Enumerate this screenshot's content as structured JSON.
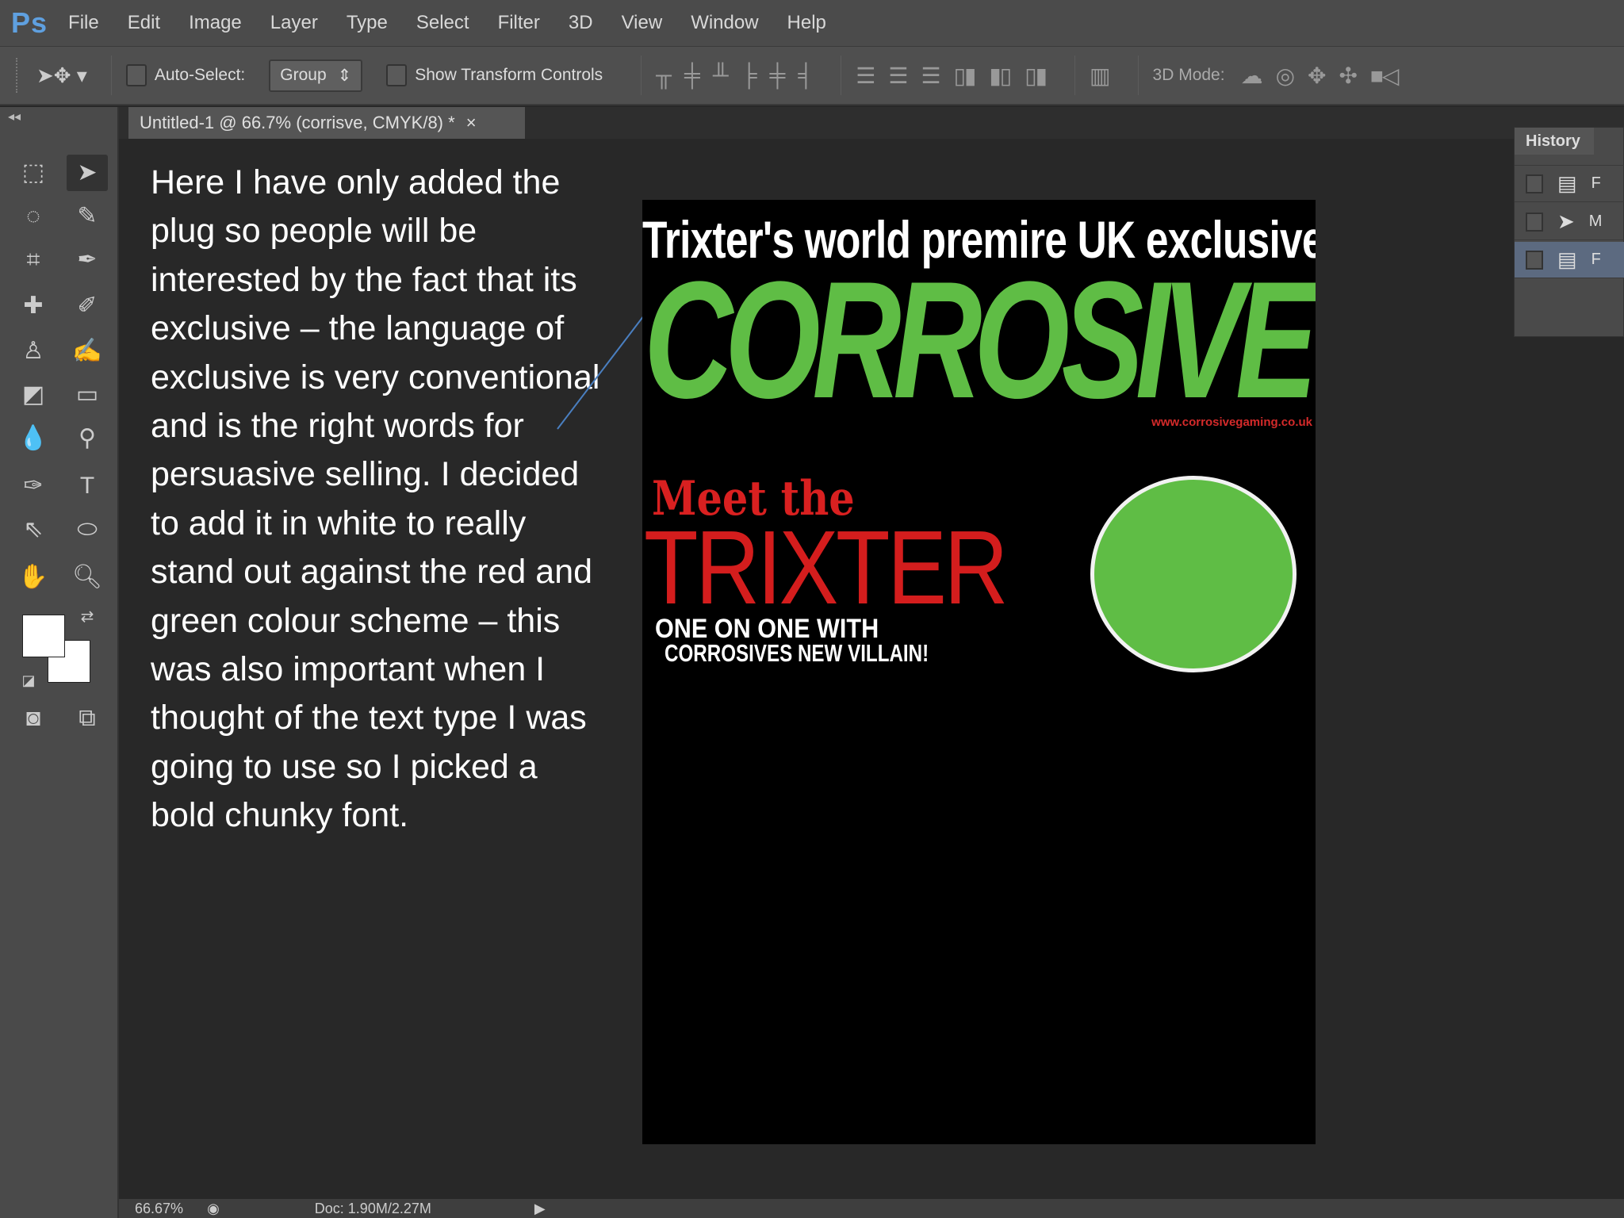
{
  "app": {
    "logo": "Ps"
  },
  "menu": [
    "File",
    "Edit",
    "Image",
    "Layer",
    "Type",
    "Select",
    "Filter",
    "3D",
    "View",
    "Window",
    "Help"
  ],
  "options": {
    "auto_select_label": "Auto-Select:",
    "group_value": "Group",
    "show_transform_label": "Show Transform Controls",
    "mode_3d_label": "3D Mode:"
  },
  "document_tab": {
    "title": "Untitled-1 @ 66.7% (corrisve, CMYK/8) *",
    "close": "×"
  },
  "annotation": "Here I have only added the plug so people will be interested by the fact that its exclusive – the language of exclusive is very conventional and is the right words for persuasive selling.  I decided to add it in white to really stand out against the red and green colour scheme – this was also important when I thought of the text type I was going to use so I picked a bold chunky font.",
  "canvas": {
    "headline": "Trixter's world premire UK exclusive !",
    "masthead": "CORROSIVE",
    "website": "www.corrosivegaming.co.uk",
    "meet": "Meet the",
    "trixter": "TRIXTER",
    "sub1": "ONE ON ONE WITH",
    "sub2": "CORROSIVES NEW VILLAIN!",
    "colors": {
      "green": "#5fbd45",
      "red": "#d41d1d"
    }
  },
  "history": {
    "title": "History",
    "items": [
      {
        "icon": "document-icon",
        "label": "F"
      },
      {
        "icon": "move-icon",
        "label": "M"
      },
      {
        "icon": "document-icon",
        "label": "F"
      }
    ]
  },
  "status": {
    "zoom": "66.67%",
    "doc": "Doc: 1.90M/2.27M",
    "arrow": "▶"
  }
}
